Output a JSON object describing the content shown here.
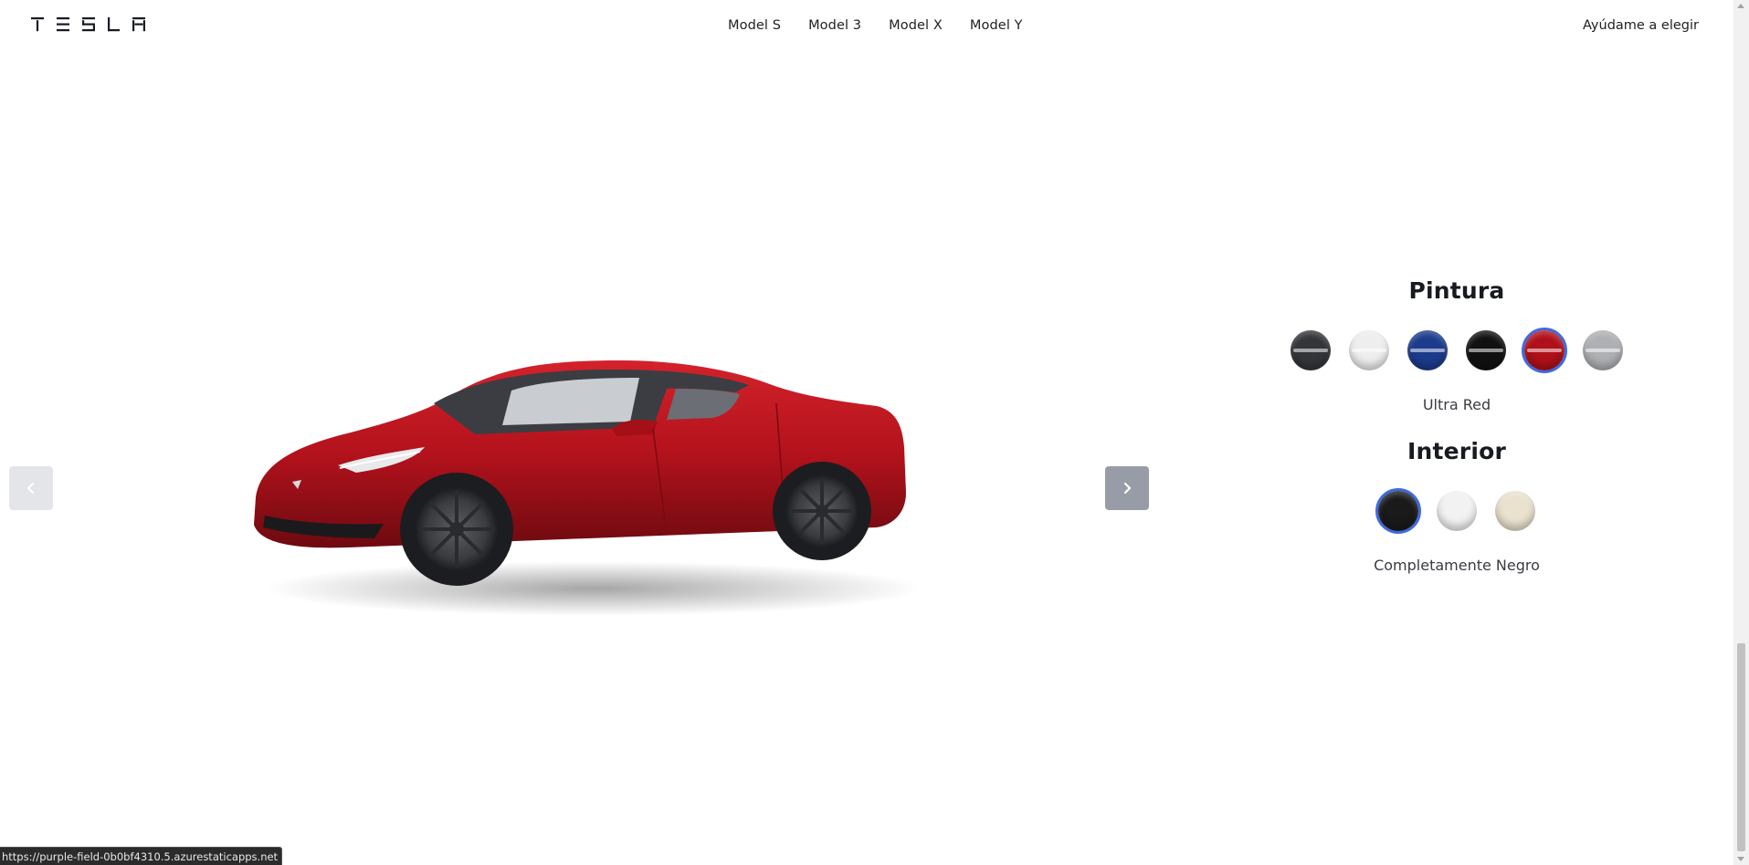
{
  "header": {
    "logo_text": "TESLA",
    "nav": [
      "Model S",
      "Model 3",
      "Model X",
      "Model Y"
    ],
    "help_label": "Ayúdame a elegir"
  },
  "paint": {
    "title": "Pintura",
    "selected_name": "Ultra Red",
    "swatches": [
      {
        "color": "#34353a",
        "selected": false
      },
      {
        "color": "#eeeeee",
        "selected": false
      },
      {
        "color": "#1c3b8c",
        "selected": false
      },
      {
        "color": "#111111",
        "selected": false
      },
      {
        "color": "#b0101a",
        "selected": true
      },
      {
        "color": "#aeb0b3",
        "selected": false
      }
    ]
  },
  "interior": {
    "title": "Interior",
    "selected_name": "Completamente Negro",
    "swatches": [
      {
        "color": "#1a1a1a",
        "selected": true
      },
      {
        "color": "#f2f2f2",
        "selected": false
      },
      {
        "color": "#eae2cf",
        "selected": false
      }
    ]
  },
  "status_bar": {
    "url": "https://purple-field-0b0bf4310.5.azurestaticapps.net"
  },
  "colors": {
    "accent": "#3e6ae1",
    "car_body": "#b3121c"
  }
}
